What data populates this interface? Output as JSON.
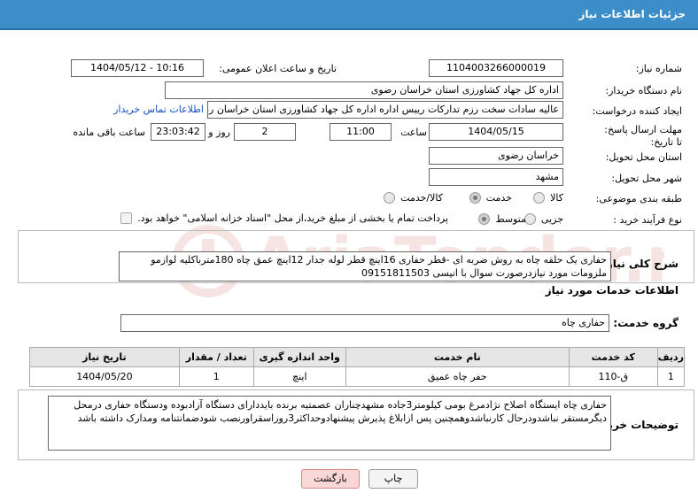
{
  "header": {
    "title": "جزئیات اطلاعات نیاز"
  },
  "fields": {
    "need_number_label": "شماره نیاز:",
    "need_number": "1104003266000019",
    "announce_label": "تاریخ و ساعت اعلان عمومی:",
    "announce_value": "1404/05/12 - 10:16",
    "buyer_org_label": "نام دستگاه خریدار:",
    "buyer_org": "اداره کل جهاد کشاورزی استان خراسان رضوی",
    "creator_label": "ایجاد کننده درخواست:",
    "creator": "عالیه سادات سخت رزم تدارکات رییس اداره  اداره کل جهاد کشاورزی استان خراسان رضوی",
    "contact_link": "اطلاعات تماس خریدار",
    "deadline_label": "مهلت ارسال پاسخ: تا تاریخ:",
    "deadline_date": "1404/05/15",
    "time_label": "ساعت",
    "deadline_time": "11:00",
    "days_value": "2",
    "days_label": "روز و",
    "remaining_time": "23:03:42",
    "remaining_label": "ساعت باقی مانده",
    "province_label": "استان محل تحویل:",
    "province": "خراسان رضوی",
    "city_label": "شهر محل تحویل:",
    "city": "مشهد",
    "category_label": "طبقه بندی موضوعی:",
    "category_options": [
      "کالا",
      "خدمت",
      "کالا/خدمت"
    ],
    "category_selected": "خدمت",
    "process_label": "نوع فرآیند خرید :",
    "process_options": [
      "جزیی",
      "متوسط"
    ],
    "process_selected": "متوسط",
    "payment_note": "پرداخت تمام یا بخشی از مبلغ خرید،از محل \"اسناد خزانه اسلامی\" خواهد بود."
  },
  "summary": {
    "label": "شرح کلی نیاز:",
    "text": "حفاری یک حلقه چاه به روش ضربه ای -قطر حفاری 16اینچ قطر لوله جدار 12اینچ عمق چاه 180مترباکلیه لوازمو ملزومات مورد نیازدرصورت سوال با انیسی 09151811503"
  },
  "services": {
    "section_title": "اطلاعات خدمات مورد نیاز",
    "group_label": "گروه خدمت:",
    "group_value": "حفاری چاه",
    "columns": [
      "ردیف",
      "کد خدمت",
      "نام خدمت",
      "واحد اندازه گیری",
      "تعداد / مقدار",
      "تاریخ نیاز"
    ],
    "rows": [
      [
        "1",
        "ق-110",
        "حفر چاه عمیق",
        "اینچ",
        "1",
        "1404/05/20"
      ]
    ]
  },
  "buyer_notes": {
    "label": "توضیحات خریدار:",
    "text": "حفاری چاه ایستگاه اصلاح نژادمرغ بومی کیلومتر3جاده مشهدچناران عصمتیه برنده بایددارای دستگاه آزادبوده ودستگاه حفاری درمحل دیگرمستقر نباشدودرحال کارنباشدوهمچنین پس ازابلاغ پذیرش پیشنهادوحداکثر3روزاسقراورنصب شودضمانتنامه ومدارک داشته باشد"
  },
  "buttons": {
    "print": "چاپ",
    "back": "بازگشت"
  },
  "colors": {
    "header": "#3c8ec8",
    "link": "#1a4fc4",
    "back_button": "#f9d7d7"
  }
}
